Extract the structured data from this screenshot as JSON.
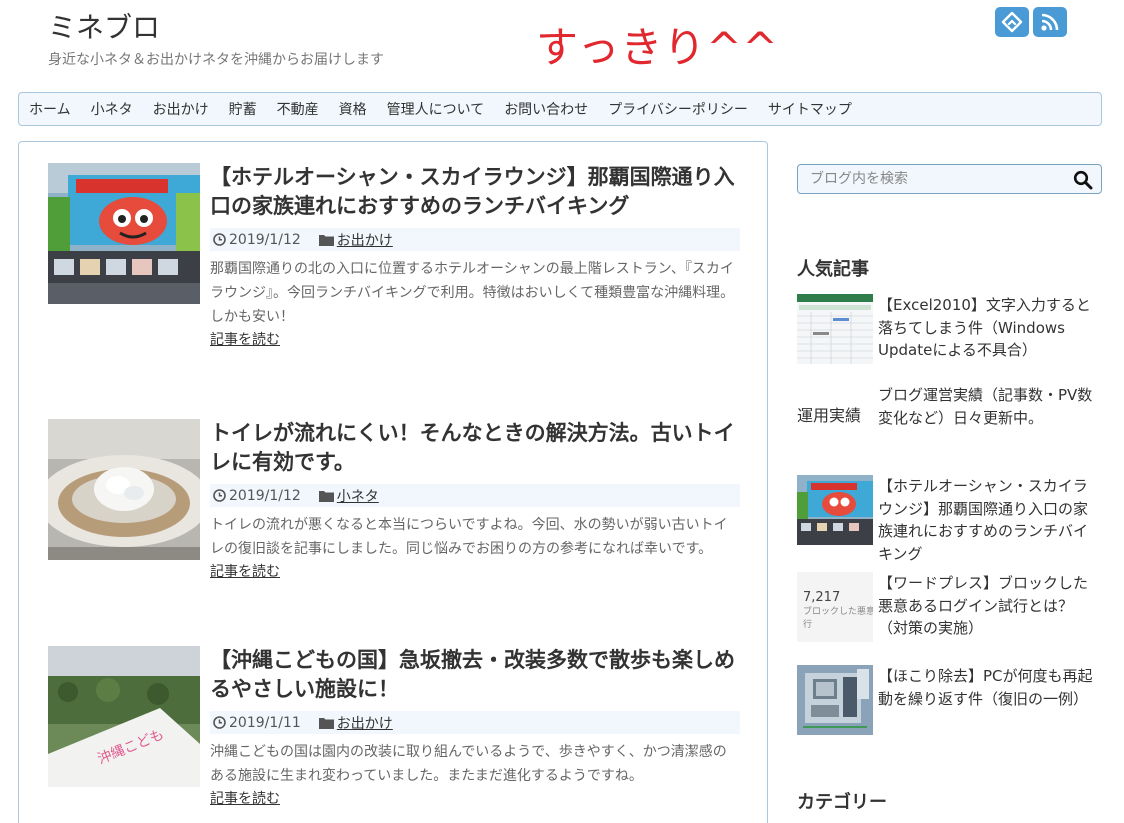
{
  "header": {
    "site_title": "ミネブロ",
    "site_description": "身近な小ネタ＆お出かけネタを沖縄からお届けします",
    "annotation": "すっきり^^",
    "social_icons": [
      "feedly-icon",
      "rss-icon"
    ],
    "accent_color": "#4a9ad6"
  },
  "nav": {
    "items": [
      "ホーム",
      "小ネタ",
      "お出かけ",
      "貯蓄",
      "不動産",
      "資格",
      "管理人について",
      "お問い合わせ",
      "プライバシーポリシー",
      "サイトマップ"
    ]
  },
  "articles": [
    {
      "title": "【ホテルオーシャン・スカイラウンジ】那覇国際通り入口の家族連れにおすすめのランチバイキング",
      "date": "2019/1/12",
      "category": "お出かけ",
      "excerpt": "那覇国際通りの北の入口に位置するホテルオーシャンの最上階レストラン、『スカイラウンジ』。今回ランチバイキングで利用。特徴はおいしくて種類豊富な沖縄料理。しかも安い！",
      "read_more": "記事を読む"
    },
    {
      "title": "トイレが流れにくい！そんなときの解決方法。古いトイレに有効です。",
      "date": "2019/1/12",
      "category": "小ネタ",
      "excerpt": "トイレの流れが悪くなると本当につらいですよね。今回、水の勢いが弱い古いトイレの復旧談を記事にしました。同じ悩みでお困りの方の参考になれば幸いです。",
      "read_more": "記事を読む"
    },
    {
      "title": "【沖縄こどもの国】急坂撤去・改装多数で散歩も楽しめるやさしい施設に！",
      "date": "2019/1/11",
      "category": "お出かけ",
      "excerpt": "沖縄こどもの国は園内の改装に取り組んでいるようで、歩きやすく、かつ清潔感のある施設に生まれ変わっていました。またまだ進化するようですね。",
      "read_more": "記事を読む"
    }
  ],
  "sidebar": {
    "search_placeholder": "ブログ内を検索",
    "popular_title": "人気記事",
    "popular": [
      {
        "title": "【Excel2010】文字入力すると落ちてしまう件（Windows Updateによる不具合）"
      },
      {
        "title": "ブログ運営実績（記事数・PV数変化など）日々更新中。",
        "thumb_alt": "運用実績"
      },
      {
        "title": "【ホテルオーシャン・スカイラウンジ】那覇国際通り入口の家族連れにおすすめのランチバイキング"
      },
      {
        "title": "【ワードプレス】ブロックした悪意あるログイン試行とは？（対策の実施）",
        "thumb_text": "7,217",
        "thumb_caption": "ブロックした悪意\n行"
      },
      {
        "title": "【ほこり除去】PCが何度も再起動を繰り返す件（復旧の一例）"
      }
    ],
    "category_title": "カテゴリー"
  }
}
